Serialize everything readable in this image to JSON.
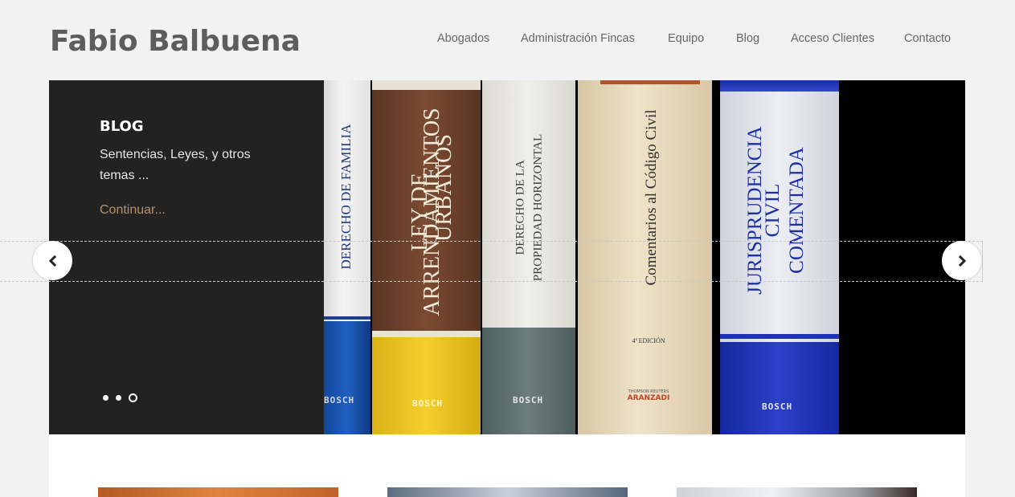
{
  "site": {
    "logo": "Fabio Balbuena"
  },
  "nav": {
    "items": [
      {
        "label": "Abogados"
      },
      {
        "label": "Administración Fincas"
      },
      {
        "label": "Equipo"
      },
      {
        "label": "Blog"
      },
      {
        "label": "Acceso Clientes"
      },
      {
        "label": "Contacto"
      }
    ]
  },
  "slide": {
    "title": "BLOG",
    "description": "Sentencias, Leyes, y otros temas ...",
    "link": "Continuar...",
    "active_dot": 3,
    "dot_count": 3
  },
  "books": [
    {
      "line1": "DERECHO DE FAMILIA",
      "line2": "",
      "publisher": "BOSCH"
    },
    {
      "line1": "LEY DE",
      "line2": "ARRENDAMIENTOS",
      "line3": "URBANOS",
      "publisher": "BOSCH"
    },
    {
      "line1": "DERECHO DE LA",
      "line2": "PROPIEDAD HORIZONTAL",
      "publisher": "BOSCH"
    },
    {
      "line1": "Comentarios al Código Civil",
      "edition": "4ª EDICIÓN",
      "publisher_small": "THOMSON REUTERS",
      "publisher": "ARANZADI"
    },
    {
      "line1": "JURISPRUDENCIA",
      "line2": "CIVIL",
      "line3": "COMENTADA",
      "publisher": "BOSCH"
    }
  ],
  "arrows": {
    "prev_icon": "chevron-left-icon",
    "next_icon": "chevron-right-icon"
  },
  "colors": {
    "panel": "#222222",
    "link": "#b9906a",
    "logo": "#5d5d5d"
  }
}
